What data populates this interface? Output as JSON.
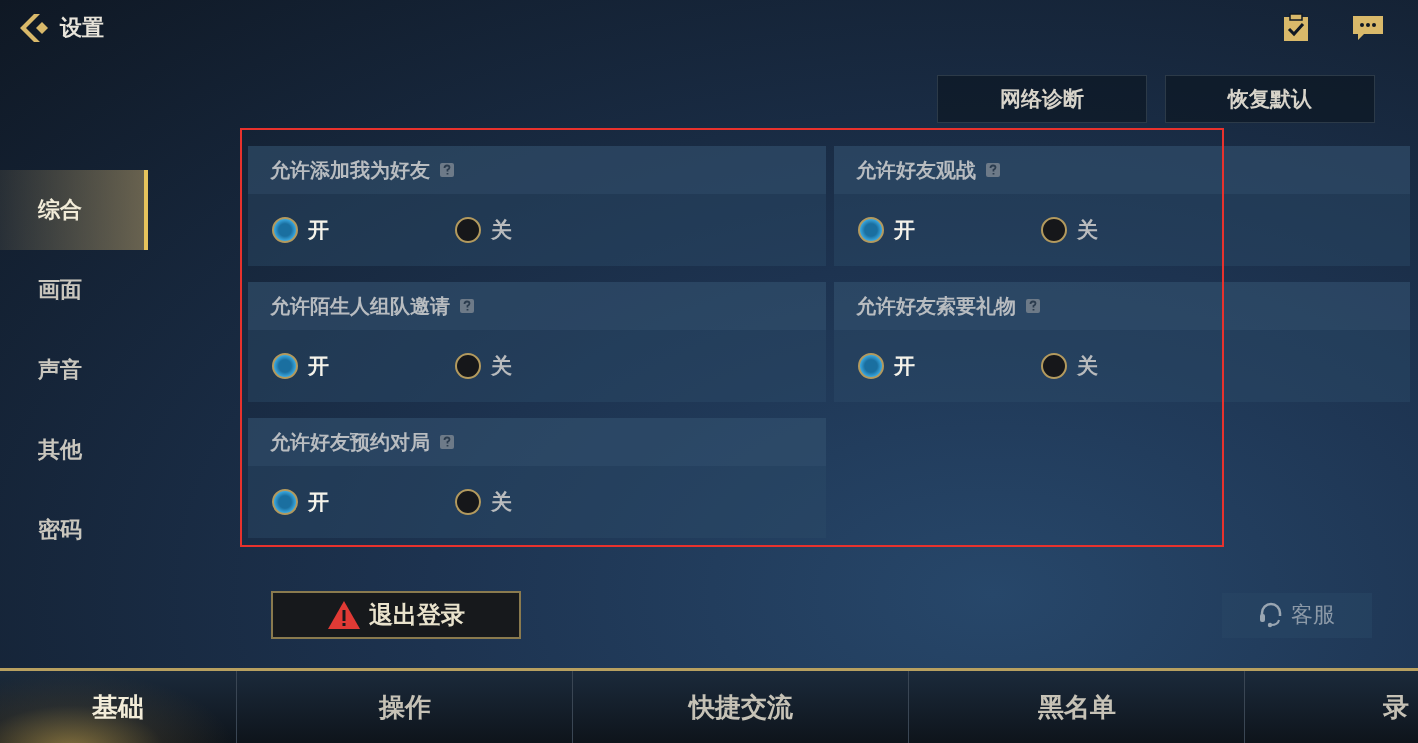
{
  "header": {
    "title": "设置"
  },
  "top_buttons": [
    "网络诊断",
    "恢复默认"
  ],
  "sidebar": {
    "items": [
      {
        "label": "综合",
        "selected": true
      },
      {
        "label": "画面",
        "selected": false
      },
      {
        "label": "声音",
        "selected": false
      },
      {
        "label": "其他",
        "selected": false
      },
      {
        "label": "密码",
        "selected": false
      }
    ]
  },
  "settings": [
    {
      "title": "允许添加我为好友",
      "options": [
        {
          "label": "开",
          "selected": true
        },
        {
          "label": "关",
          "selected": false
        }
      ]
    },
    {
      "title": "允许好友观战",
      "options": [
        {
          "label": "开",
          "selected": true
        },
        {
          "label": "关",
          "selected": false
        }
      ]
    },
    {
      "title": "允许陌生人组队邀请",
      "options": [
        {
          "label": "开",
          "selected": true
        },
        {
          "label": "关",
          "selected": false
        }
      ]
    },
    {
      "title": "允许好友索要礼物",
      "options": [
        {
          "label": "开",
          "selected": true
        },
        {
          "label": "关",
          "selected": false
        }
      ]
    },
    {
      "title": "允许好友预约对局",
      "options": [
        {
          "label": "开",
          "selected": true
        },
        {
          "label": "关",
          "selected": false
        }
      ]
    }
  ],
  "logout_button": "退出登录",
  "service_button": "客服",
  "bottom_tabs": [
    {
      "label": "基础",
      "selected": true
    },
    {
      "label": "操作",
      "selected": false
    },
    {
      "label": "快捷交流",
      "selected": false
    },
    {
      "label": "黑名单",
      "selected": false
    },
    {
      "label": "录",
      "selected": false
    }
  ]
}
